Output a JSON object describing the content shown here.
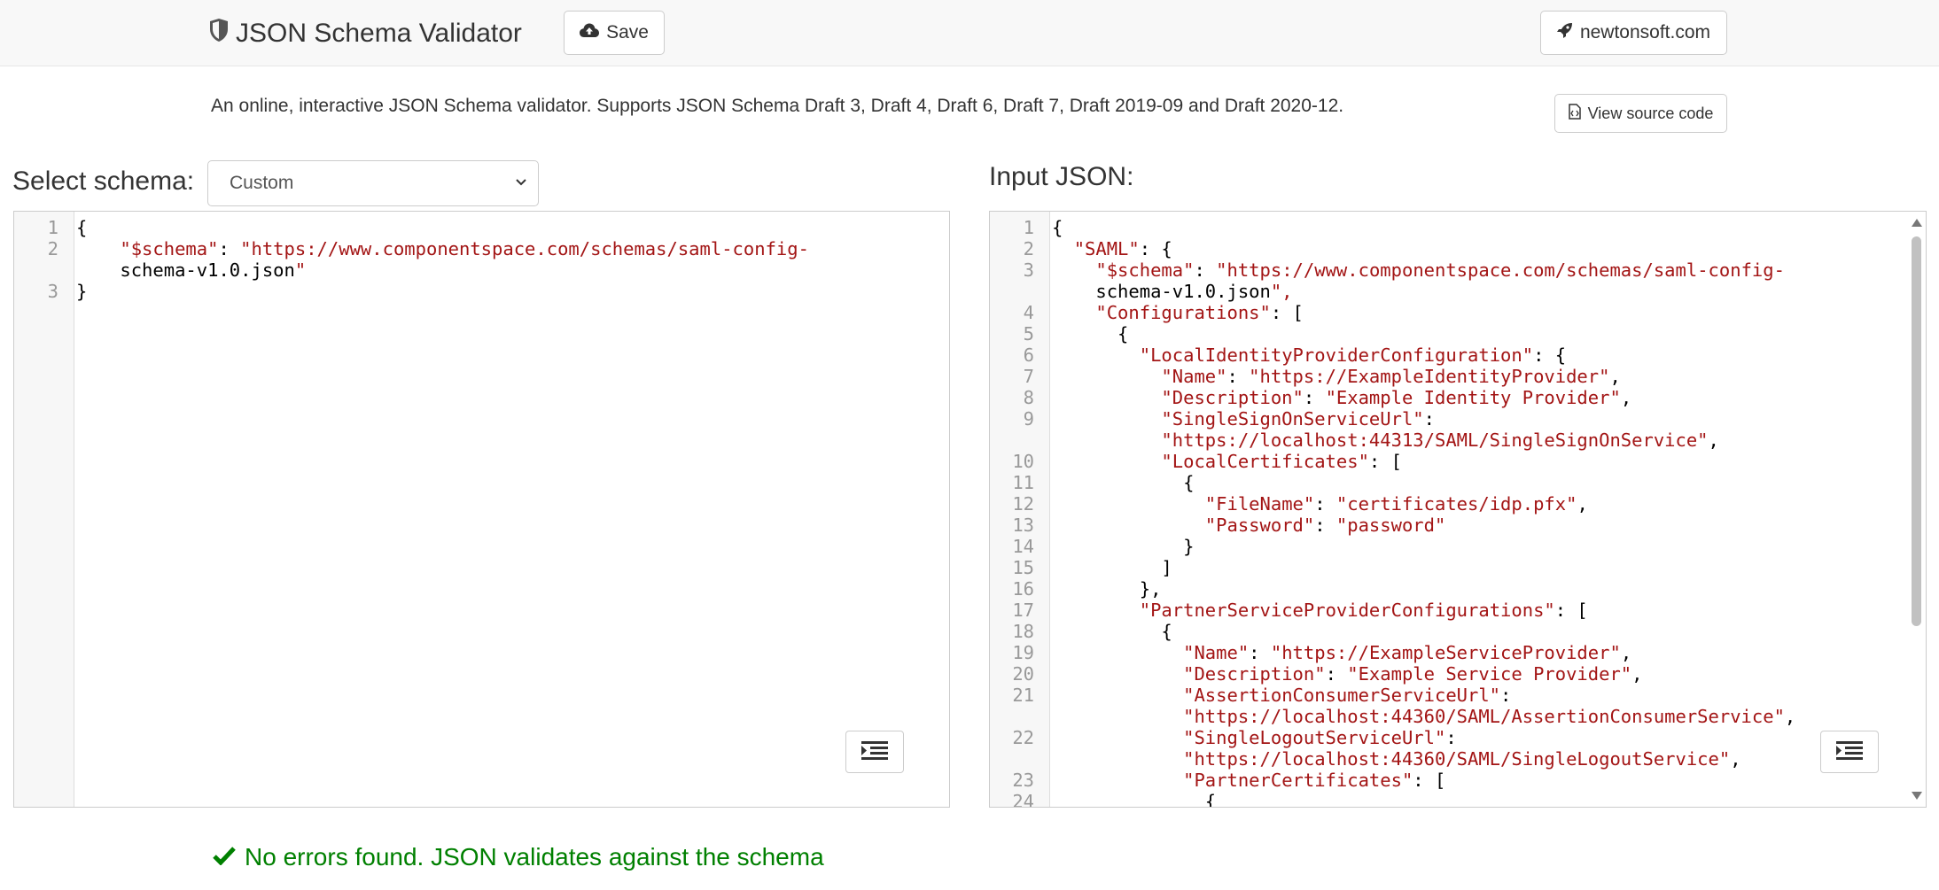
{
  "header": {
    "brand_title": "JSON Schema Validator",
    "brand_icon": "shield-icon",
    "save_label": "Save",
    "save_icon": "cloud-upload-icon",
    "newtonsoft_label": "newtonsoft.com",
    "newtonsoft_icon": "rocket-icon"
  },
  "intro": {
    "text": "An online, interactive JSON Schema validator. Supports JSON Schema Draft 3, Draft 4, Draft 6, Draft 7, Draft 2019-09 and Draft 2020-12.",
    "view_source_label": "View source code",
    "view_source_icon": "file-code-icon"
  },
  "schema_panel": {
    "label": "Select schema:",
    "selected": "Custom",
    "lines": [
      {
        "n": "1",
        "text": "{"
      },
      {
        "n": "2",
        "text": "    \"$schema\": \"https://www.componentspace.com/schemas/saml-config-"
      },
      {
        "n": "",
        "text": "    schema-v1.0.json\""
      },
      {
        "n": "3",
        "text": "}"
      }
    ]
  },
  "input_panel": {
    "label": "Input JSON:",
    "lines": [
      {
        "n": "1",
        "text": "{"
      },
      {
        "n": "2",
        "text": "  \"SAML\": {"
      },
      {
        "n": "3",
        "text": "    \"$schema\": \"https://www.componentspace.com/schemas/saml-config-"
      },
      {
        "n": "",
        "text": "    schema-v1.0.json\","
      },
      {
        "n": "4",
        "text": "    \"Configurations\": ["
      },
      {
        "n": "5",
        "text": "      {"
      },
      {
        "n": "6",
        "text": "        \"LocalIdentityProviderConfiguration\": {"
      },
      {
        "n": "7",
        "text": "          \"Name\": \"https://ExampleIdentityProvider\","
      },
      {
        "n": "8",
        "text": "          \"Description\": \"Example Identity Provider\","
      },
      {
        "n": "9",
        "text": "          \"SingleSignOnServiceUrl\":"
      },
      {
        "n": "",
        "text": "          \"https://localhost:44313/SAML/SingleSignOnService\","
      },
      {
        "n": "10",
        "text": "          \"LocalCertificates\": ["
      },
      {
        "n": "11",
        "text": "            {"
      },
      {
        "n": "12",
        "text": "              \"FileName\": \"certificates/idp.pfx\","
      },
      {
        "n": "13",
        "text": "              \"Password\": \"password\""
      },
      {
        "n": "14",
        "text": "            }"
      },
      {
        "n": "15",
        "text": "          ]"
      },
      {
        "n": "16",
        "text": "        },"
      },
      {
        "n": "17",
        "text": "        \"PartnerServiceProviderConfigurations\": ["
      },
      {
        "n": "18",
        "text": "          {"
      },
      {
        "n": "19",
        "text": "            \"Name\": \"https://ExampleServiceProvider\","
      },
      {
        "n": "20",
        "text": "            \"Description\": \"Example Service Provider\","
      },
      {
        "n": "21",
        "text": "            \"AssertionConsumerServiceUrl\":"
      },
      {
        "n": "",
        "text": "            \"https://localhost:44360/SAML/AssertionConsumerService\","
      },
      {
        "n": "22",
        "text": "            \"SingleLogoutServiceUrl\":"
      },
      {
        "n": "",
        "text": "            \"https://localhost:44360/SAML/SingleLogoutService\","
      },
      {
        "n": "23",
        "text": "            \"PartnerCertificates\": ["
      },
      {
        "n": "24",
        "text": "              {"
      }
    ]
  },
  "result": {
    "icon": "check-icon",
    "text": "No errors found. JSON validates against the schema",
    "color": "#008000"
  },
  "colors": {
    "string": "#a31515",
    "gutter": "#f7f7f7",
    "navbar": "#f8f8f8"
  }
}
